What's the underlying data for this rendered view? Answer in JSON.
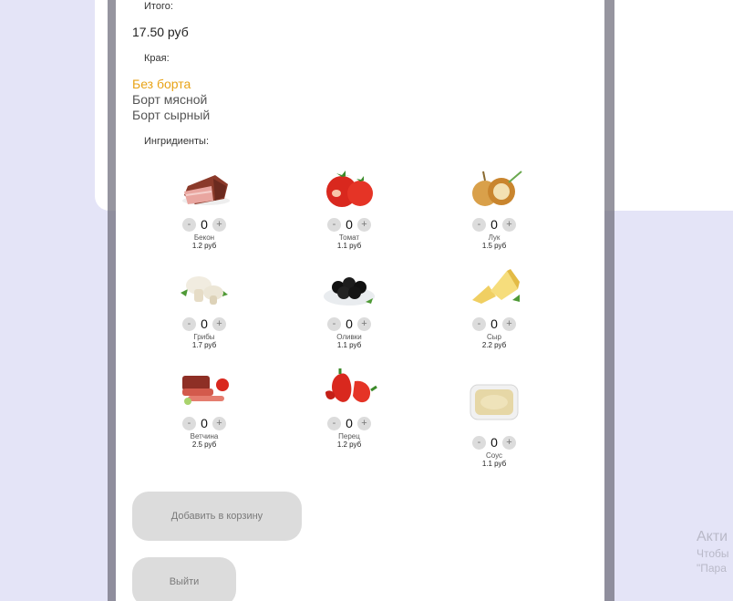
{
  "order": {
    "total_label": "Итого:",
    "total_value": "17.50 руб",
    "edges_label": "Края:",
    "edges": [
      {
        "label": "Без борта",
        "selected": true
      },
      {
        "label": "Борт мясной",
        "selected": false
      },
      {
        "label": "Борт сырный",
        "selected": false
      }
    ],
    "ingredients_label": "Ингридиенты:",
    "ingredients": [
      {
        "name": "Бекон",
        "price": "1.2 руб",
        "qty": "0",
        "icon": "bacon-icon"
      },
      {
        "name": "Томат",
        "price": "1.1 руб",
        "qty": "0",
        "icon": "tomato-icon"
      },
      {
        "name": "Лук",
        "price": "1.5 руб",
        "qty": "0",
        "icon": "onion-icon"
      },
      {
        "name": "Грибы",
        "price": "1.7 руб",
        "qty": "0",
        "icon": "mushroom-icon"
      },
      {
        "name": "Оливки",
        "price": "1.1 руб",
        "qty": "0",
        "icon": "olives-icon"
      },
      {
        "name": "Сыр",
        "price": "2.2 руб",
        "qty": "0",
        "icon": "cheese-icon"
      },
      {
        "name": "Ветчина",
        "price": "2.5 руб",
        "qty": "0",
        "icon": "ham-icon"
      },
      {
        "name": "Перец",
        "price": "1.2 руб",
        "qty": "0",
        "icon": "pepper-icon"
      },
      {
        "name": "Соус",
        "price": "1.1 руб",
        "qty": "0",
        "icon": "sauce-icon"
      }
    ],
    "stepper": {
      "minus": "-",
      "plus": "+"
    },
    "add_to_cart_label": "Добавить в корзину",
    "exit_label": "Выйти"
  },
  "activation": {
    "line1": "Акти",
    "line2": "Чтобы",
    "line3": "\"Пара"
  },
  "colors": {
    "accent_selected": "#e8a317",
    "page_bg": "#e4e4f7",
    "button_bg": "#dcdcdc"
  }
}
